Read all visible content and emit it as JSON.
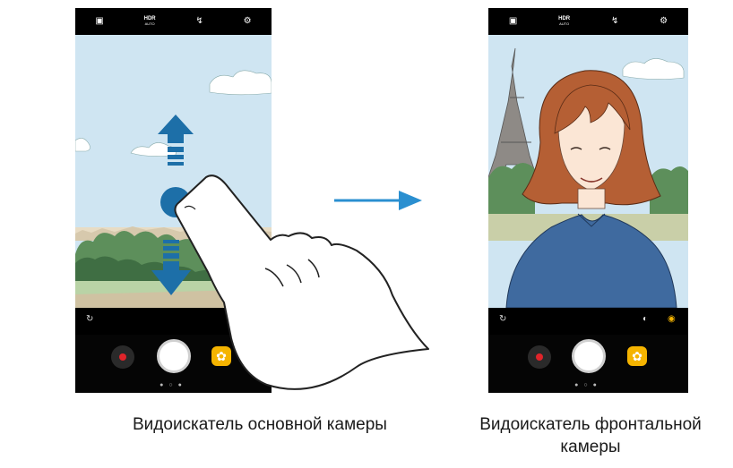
{
  "left_phone": {
    "top_icons": [
      "camera-settings-icon",
      "hdr-icon",
      "flash-off-icon",
      "gear-icon"
    ],
    "hdr_label": "HDR",
    "hdr_sub": "AUTO",
    "mode_icons": [
      "switch-camera-icon"
    ],
    "controls": [
      "record-button",
      "shutter-button",
      "effects-button"
    ]
  },
  "right_phone": {
    "top_icons": [
      "camera-settings-icon",
      "hdr-icon",
      "flash-off-icon",
      "gear-icon"
    ],
    "hdr_label": "HDR",
    "hdr_sub": "AUTO",
    "mode_icons": [
      "switch-camera-icon",
      "beauty-icon",
      "mask-icon"
    ],
    "controls": [
      "record-button",
      "shutter-button",
      "effects-button"
    ]
  },
  "captions": {
    "left": "Видоискатель основной камеры",
    "right_line1": "Видоискатель фронтальной",
    "right_line2": "камеры"
  },
  "colors": {
    "sky": "#cfe5f2",
    "gesture_blue": "#1d6fa8",
    "arrow_blue": "#2a8fd0",
    "record_red": "#e0242a",
    "effects_yellow": "#f5b400"
  }
}
